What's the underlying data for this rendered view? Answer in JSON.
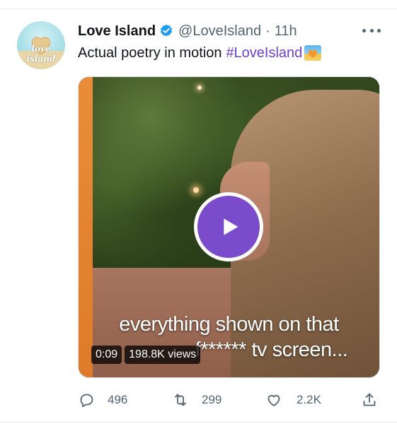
{
  "tweet": {
    "author_name": "Love Island",
    "handle": "@LoveIsland",
    "separator": "·",
    "time": "11h",
    "avatar_text": "love island",
    "text": "Actual poetry in motion",
    "hashtag": "#LoveIsland",
    "emoji": "sunset-emoji"
  },
  "video": {
    "caption_line1": "everything shown on that",
    "caption_line2": "f****** tv screen...",
    "duration": "0:09",
    "views": "198.8K views"
  },
  "actions": {
    "replies": "496",
    "retweets": "299",
    "likes": "2.2K"
  },
  "colors": {
    "hashtag": "#6b3fd3",
    "verified": "#1d9bf0",
    "play_button": "#7a4ccc",
    "muted_text": "#536471"
  },
  "icons": [
    "verified-badge-icon",
    "more-icon",
    "play-icon",
    "reply-icon",
    "retweet-icon",
    "like-icon",
    "share-icon"
  ]
}
